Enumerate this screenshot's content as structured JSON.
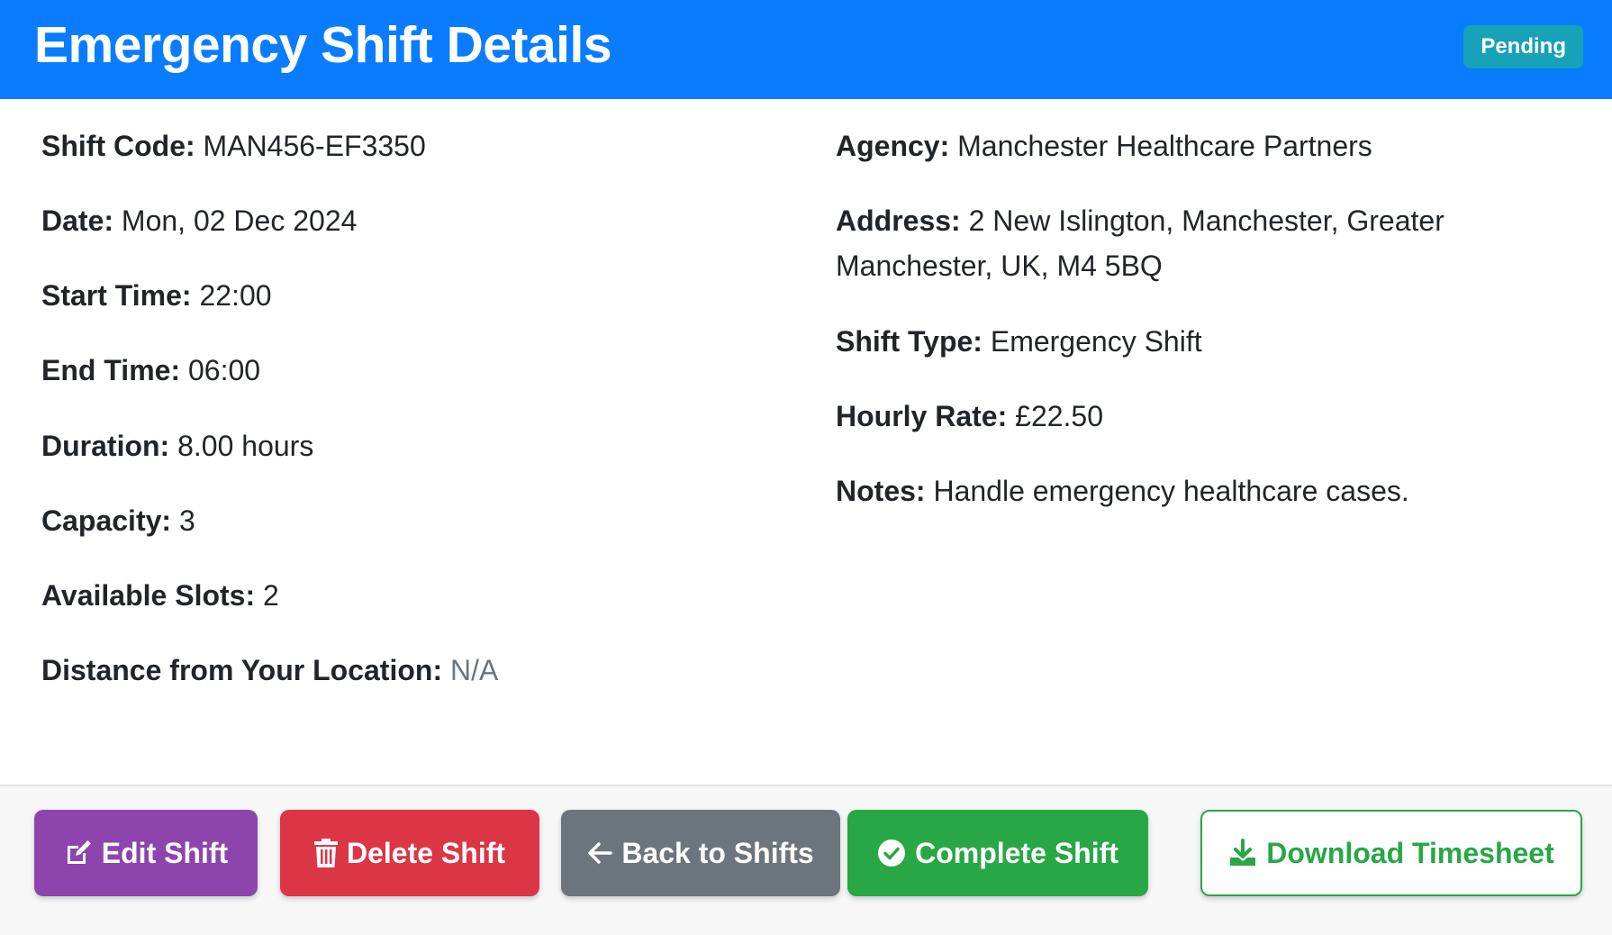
{
  "header": {
    "title": "Emergency Shift Details",
    "status": "Pending"
  },
  "left_fields": [
    {
      "label": "Shift Code:",
      "value": "MAN456-EF3350"
    },
    {
      "label": "Date:",
      "value": "Mon, 02 Dec 2024"
    },
    {
      "label": "Start Time:",
      "value": "22:00"
    },
    {
      "label": "End Time:",
      "value": "06:00"
    },
    {
      "label": "Duration:",
      "value": "8.00 hours"
    },
    {
      "label": "Capacity:",
      "value": "3"
    },
    {
      "label": "Available Slots:",
      "value": "2"
    },
    {
      "label": "Distance from Your Location:",
      "value": "N/A"
    }
  ],
  "right_fields": [
    {
      "label": "Agency:",
      "value": "Manchester Healthcare Partners"
    },
    {
      "label": "Address:",
      "value": "2 New Islington, Manchester, Greater",
      "value_line2": "Manchester, UK, M4 5BQ"
    },
    {
      "label": "Shift Type:",
      "value": "Emergency Shift"
    },
    {
      "label": "Hourly Rate:",
      "value": "£22.50"
    },
    {
      "label": "Notes:",
      "value": "Handle emergency healthcare cases."
    }
  ],
  "actions": {
    "edit": {
      "label": "Edit Shift",
      "icon": "edit-icon"
    },
    "delete": {
      "label": "Delete Shift",
      "icon": "trash-icon"
    },
    "back": {
      "label": "Back to Shifts",
      "icon": "arrow-left-icon"
    },
    "complete": {
      "label": "Complete Shift",
      "icon": "check-circle-icon"
    },
    "download": {
      "label": "Download Timesheet",
      "icon": "download-icon"
    }
  },
  "colors": {
    "header": "#0a7cff",
    "badge": "#17a2b8",
    "edit": "#8e44ad",
    "delete": "#dc3545",
    "back": "#6c757d",
    "complete": "#28a745"
  }
}
